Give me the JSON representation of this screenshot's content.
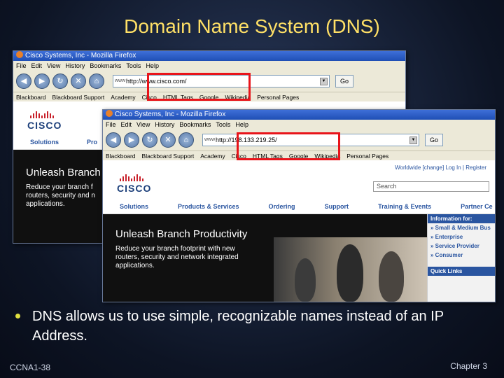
{
  "slide": {
    "title": "Domain Name System (DNS)",
    "bullet": "DNS allows us to use simple, recognizable names instead of an IP Address.",
    "footer_left": "CCNA1-38",
    "footer_right": "Chapter 3",
    "title_color": "#ffe066",
    "highlight_color": "#e8141a"
  },
  "window1": {
    "title": "Cisco Systems, Inc - Mozilla Firefox",
    "menu": [
      "File",
      "Edit",
      "View",
      "History",
      "Bookmarks",
      "Tools",
      "Help"
    ],
    "url": "http://www.cisco.com/",
    "go_label": "Go",
    "bookmarks": [
      "Blackboard",
      "Blackboard Support",
      "Academy",
      "Cisco",
      "HTML Tags",
      "Google",
      "Wikipedia",
      "Personal Pages"
    ],
    "nav": [
      "Solutions",
      "Pro"
    ],
    "hero_title": "Unleash Branch",
    "hero_sub": [
      "Reduce your branch f",
      "routers, security and n",
      "applications."
    ]
  },
  "window2": {
    "title": "Cisco Systems, Inc - Mozilla Firefox",
    "menu": [
      "File",
      "Edit",
      "View",
      "History",
      "Bookmarks",
      "Tools",
      "Help"
    ],
    "url": "http://198.133.219.25/",
    "go_label": "Go",
    "bookmarks": [
      "Blackboard",
      "Blackboard Support",
      "Academy",
      "Cisco",
      "HTML Tags",
      "Google",
      "Wikipedia",
      "Personal Pages"
    ],
    "top_links": "Worldwide [change]   Log In | Register",
    "search_placeholder": "Search",
    "nav": [
      "Solutions",
      "Products & Services",
      "Ordering",
      "Support",
      "Training & Events",
      "Partner Ce"
    ],
    "hero_title": "Unleash Branch Productivity",
    "hero_sub": [
      "Reduce your branch footprint with new",
      "routers, security and network integrated",
      "applications."
    ],
    "info_header": "Information for:",
    "info_items": [
      "» Small & Medium Bus",
      "» Enterprise",
      "» Service Provider",
      "» Consumer"
    ],
    "quick_links": "Quick Links"
  }
}
